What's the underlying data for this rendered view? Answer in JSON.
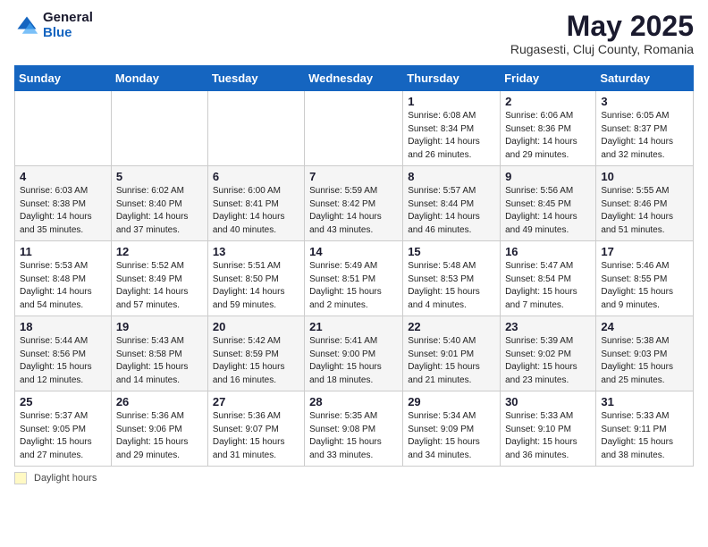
{
  "header": {
    "logo_general": "General",
    "logo_blue": "Blue",
    "title": "May 2025",
    "subtitle": "Rugasesti, Cluj County, Romania"
  },
  "days_of_week": [
    "Sunday",
    "Monday",
    "Tuesday",
    "Wednesday",
    "Thursday",
    "Friday",
    "Saturday"
  ],
  "weeks": [
    [
      {
        "day": "",
        "info": ""
      },
      {
        "day": "",
        "info": ""
      },
      {
        "day": "",
        "info": ""
      },
      {
        "day": "",
        "info": ""
      },
      {
        "day": "1",
        "info": "Sunrise: 6:08 AM\nSunset: 8:34 PM\nDaylight: 14 hours\nand 26 minutes."
      },
      {
        "day": "2",
        "info": "Sunrise: 6:06 AM\nSunset: 8:36 PM\nDaylight: 14 hours\nand 29 minutes."
      },
      {
        "day": "3",
        "info": "Sunrise: 6:05 AM\nSunset: 8:37 PM\nDaylight: 14 hours\nand 32 minutes."
      }
    ],
    [
      {
        "day": "4",
        "info": "Sunrise: 6:03 AM\nSunset: 8:38 PM\nDaylight: 14 hours\nand 35 minutes."
      },
      {
        "day": "5",
        "info": "Sunrise: 6:02 AM\nSunset: 8:40 PM\nDaylight: 14 hours\nand 37 minutes."
      },
      {
        "day": "6",
        "info": "Sunrise: 6:00 AM\nSunset: 8:41 PM\nDaylight: 14 hours\nand 40 minutes."
      },
      {
        "day": "7",
        "info": "Sunrise: 5:59 AM\nSunset: 8:42 PM\nDaylight: 14 hours\nand 43 minutes."
      },
      {
        "day": "8",
        "info": "Sunrise: 5:57 AM\nSunset: 8:44 PM\nDaylight: 14 hours\nand 46 minutes."
      },
      {
        "day": "9",
        "info": "Sunrise: 5:56 AM\nSunset: 8:45 PM\nDaylight: 14 hours\nand 49 minutes."
      },
      {
        "day": "10",
        "info": "Sunrise: 5:55 AM\nSunset: 8:46 PM\nDaylight: 14 hours\nand 51 minutes."
      }
    ],
    [
      {
        "day": "11",
        "info": "Sunrise: 5:53 AM\nSunset: 8:48 PM\nDaylight: 14 hours\nand 54 minutes."
      },
      {
        "day": "12",
        "info": "Sunrise: 5:52 AM\nSunset: 8:49 PM\nDaylight: 14 hours\nand 57 minutes."
      },
      {
        "day": "13",
        "info": "Sunrise: 5:51 AM\nSunset: 8:50 PM\nDaylight: 14 hours\nand 59 minutes."
      },
      {
        "day": "14",
        "info": "Sunrise: 5:49 AM\nSunset: 8:51 PM\nDaylight: 15 hours\nand 2 minutes."
      },
      {
        "day": "15",
        "info": "Sunrise: 5:48 AM\nSunset: 8:53 PM\nDaylight: 15 hours\nand 4 minutes."
      },
      {
        "day": "16",
        "info": "Sunrise: 5:47 AM\nSunset: 8:54 PM\nDaylight: 15 hours\nand 7 minutes."
      },
      {
        "day": "17",
        "info": "Sunrise: 5:46 AM\nSunset: 8:55 PM\nDaylight: 15 hours\nand 9 minutes."
      }
    ],
    [
      {
        "day": "18",
        "info": "Sunrise: 5:44 AM\nSunset: 8:56 PM\nDaylight: 15 hours\nand 12 minutes."
      },
      {
        "day": "19",
        "info": "Sunrise: 5:43 AM\nSunset: 8:58 PM\nDaylight: 15 hours\nand 14 minutes."
      },
      {
        "day": "20",
        "info": "Sunrise: 5:42 AM\nSunset: 8:59 PM\nDaylight: 15 hours\nand 16 minutes."
      },
      {
        "day": "21",
        "info": "Sunrise: 5:41 AM\nSunset: 9:00 PM\nDaylight: 15 hours\nand 18 minutes."
      },
      {
        "day": "22",
        "info": "Sunrise: 5:40 AM\nSunset: 9:01 PM\nDaylight: 15 hours\nand 21 minutes."
      },
      {
        "day": "23",
        "info": "Sunrise: 5:39 AM\nSunset: 9:02 PM\nDaylight: 15 hours\nand 23 minutes."
      },
      {
        "day": "24",
        "info": "Sunrise: 5:38 AM\nSunset: 9:03 PM\nDaylight: 15 hours\nand 25 minutes."
      }
    ],
    [
      {
        "day": "25",
        "info": "Sunrise: 5:37 AM\nSunset: 9:05 PM\nDaylight: 15 hours\nand 27 minutes."
      },
      {
        "day": "26",
        "info": "Sunrise: 5:36 AM\nSunset: 9:06 PM\nDaylight: 15 hours\nand 29 minutes."
      },
      {
        "day": "27",
        "info": "Sunrise: 5:36 AM\nSunset: 9:07 PM\nDaylight: 15 hours\nand 31 minutes."
      },
      {
        "day": "28",
        "info": "Sunrise: 5:35 AM\nSunset: 9:08 PM\nDaylight: 15 hours\nand 33 minutes."
      },
      {
        "day": "29",
        "info": "Sunrise: 5:34 AM\nSunset: 9:09 PM\nDaylight: 15 hours\nand 34 minutes."
      },
      {
        "day": "30",
        "info": "Sunrise: 5:33 AM\nSunset: 9:10 PM\nDaylight: 15 hours\nand 36 minutes."
      },
      {
        "day": "31",
        "info": "Sunrise: 5:33 AM\nSunset: 9:11 PM\nDaylight: 15 hours\nand 38 minutes."
      }
    ]
  ],
  "footer": {
    "daylight_label": "Daylight hours"
  }
}
